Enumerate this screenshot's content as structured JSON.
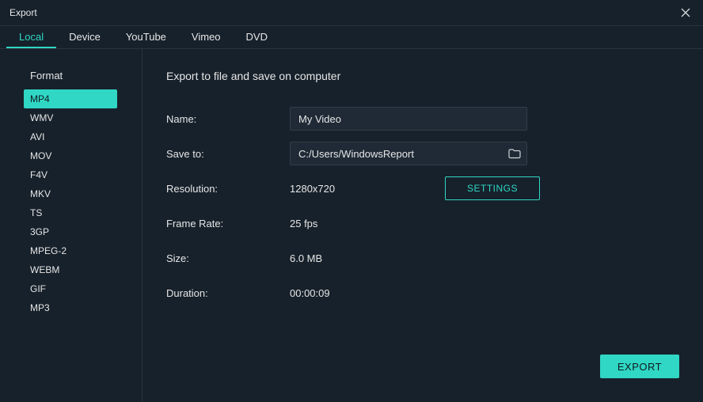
{
  "window": {
    "title": "Export"
  },
  "tabs": [
    {
      "label": "Local"
    },
    {
      "label": "Device"
    },
    {
      "label": "YouTube"
    },
    {
      "label": "Vimeo"
    },
    {
      "label": "DVD"
    }
  ],
  "active_tab": "Local",
  "sidebar": {
    "heading": "Format",
    "items": [
      {
        "label": "MP4"
      },
      {
        "label": "WMV"
      },
      {
        "label": "AVI"
      },
      {
        "label": "MOV"
      },
      {
        "label": "F4V"
      },
      {
        "label": "MKV"
      },
      {
        "label": "TS"
      },
      {
        "label": "3GP"
      },
      {
        "label": "MPEG-2"
      },
      {
        "label": "WEBM"
      },
      {
        "label": "GIF"
      },
      {
        "label": "MP3"
      }
    ],
    "selected": "MP4"
  },
  "main": {
    "heading": "Export to file and save on computer",
    "name_label": "Name:",
    "name_value": "My Video",
    "saveto_label": "Save to:",
    "saveto_value": "C:/Users/WindowsReport",
    "resolution_label": "Resolution:",
    "resolution_value": "1280x720",
    "settings_button": "SETTINGS",
    "framerate_label": "Frame Rate:",
    "framerate_value": "25 fps",
    "size_label": "Size:",
    "size_value": "6.0 MB",
    "duration_label": "Duration:",
    "duration_value": "00:00:09",
    "export_button": "EXPORT"
  },
  "colors": {
    "accent": "#2fd7c4",
    "bg": "#17212b",
    "panel": "#1f2a36",
    "border": "#2a3440"
  }
}
